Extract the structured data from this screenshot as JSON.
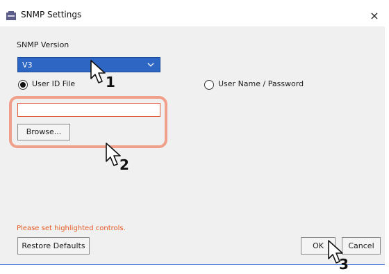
{
  "window": {
    "title": "SNMP Settings",
    "close_glyph": "×",
    "icon": "settings-window-icon"
  },
  "snmp": {
    "version_label": "SNMP Version",
    "version_value": "V3",
    "dropdown_icon": "chevron-down-icon"
  },
  "auth": {
    "option_userid": "User ID File",
    "option_username": "User Name / Password",
    "selected": "User ID File"
  },
  "file": {
    "value": "",
    "browse_label": "Browse..."
  },
  "footer": {
    "error_message": "Please set highlighted controls.",
    "restore_label": "Restore Defaults",
    "ok_label": "OK",
    "cancel_label": "Cancel"
  },
  "callouts": {
    "step1": "1",
    "step2": "2",
    "step3": "3"
  },
  "colors": {
    "dialog_bg": "#f0f0f0",
    "select_bg": "#2e66c4",
    "error_text": "#e35b25",
    "highlight_border": "#f0a08a",
    "invalid_border": "#e05a3b"
  }
}
